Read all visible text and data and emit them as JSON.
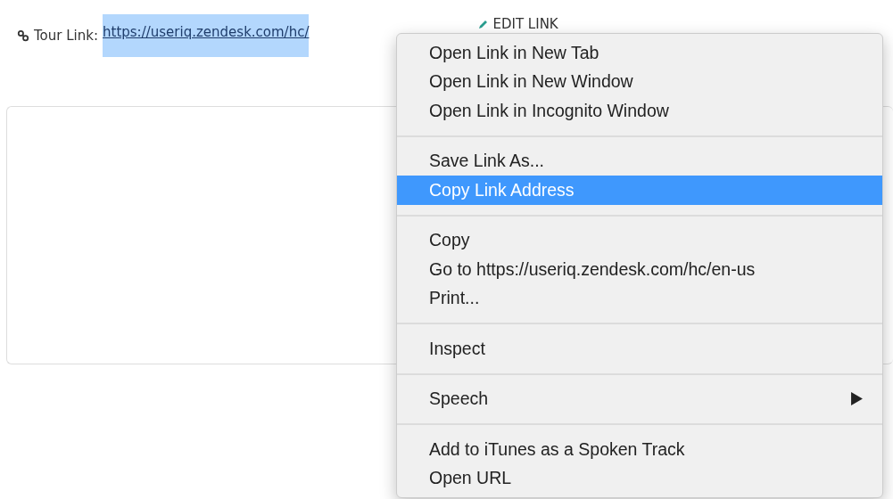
{
  "tour_link": {
    "label": "Tour Link:",
    "url": "https://useriq.zendesk.com/hc/",
    "selected": true,
    "edit_label": "EDIT LINK"
  },
  "context_menu": {
    "groups": [
      {
        "items": [
          {
            "label": "Open Link in New Tab",
            "kind": "action",
            "selected": false
          },
          {
            "label": "Open Link in New Window",
            "kind": "action",
            "selected": false
          },
          {
            "label": "Open Link in Incognito Window",
            "kind": "action",
            "selected": false
          }
        ]
      },
      {
        "items": [
          {
            "label": "Save Link As...",
            "kind": "action",
            "selected": false
          },
          {
            "label": "Copy Link Address",
            "kind": "action",
            "selected": true
          }
        ]
      },
      {
        "items": [
          {
            "label": "Copy",
            "kind": "action",
            "selected": false
          },
          {
            "label": "Go to https://useriq.zendesk.com/hc/en-us",
            "kind": "action",
            "selected": false
          },
          {
            "label": "Print...",
            "kind": "action",
            "selected": false
          }
        ]
      },
      {
        "items": [
          {
            "label": "Inspect",
            "kind": "action",
            "selected": false
          }
        ]
      },
      {
        "items": [
          {
            "label": "Speech",
            "kind": "submenu",
            "selected": false
          }
        ]
      },
      {
        "items": [
          {
            "label": "Add to iTunes as a Spoken Track",
            "kind": "action",
            "selected": false
          },
          {
            "label": "Open URL",
            "kind": "action",
            "selected": false
          }
        ]
      }
    ]
  }
}
